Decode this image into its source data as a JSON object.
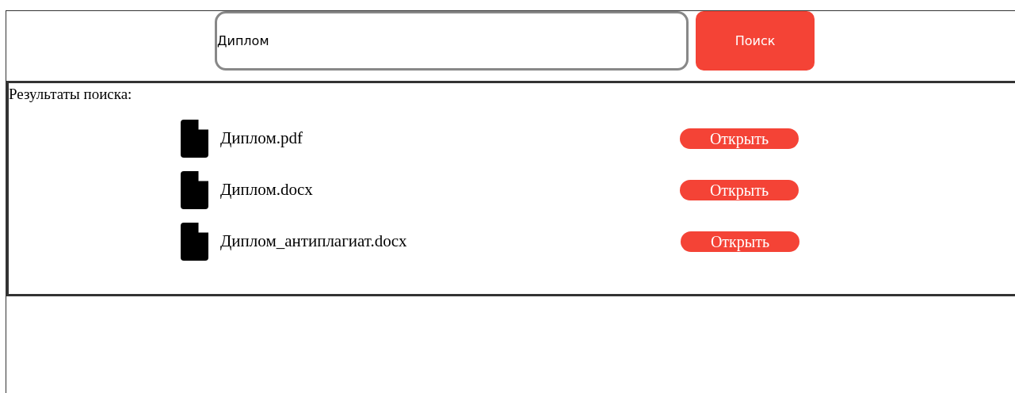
{
  "search": {
    "value": "Диплом",
    "button": "Поиск"
  },
  "results": {
    "title": "Результаты поиска:",
    "items": [
      {
        "name": "Диплом.pdf",
        "action": "Открыть"
      },
      {
        "name": "Диплом.docx",
        "action": "Открыть"
      },
      {
        "name": "Диплом_антиплагиат.docx",
        "action": "Открыть"
      }
    ]
  }
}
